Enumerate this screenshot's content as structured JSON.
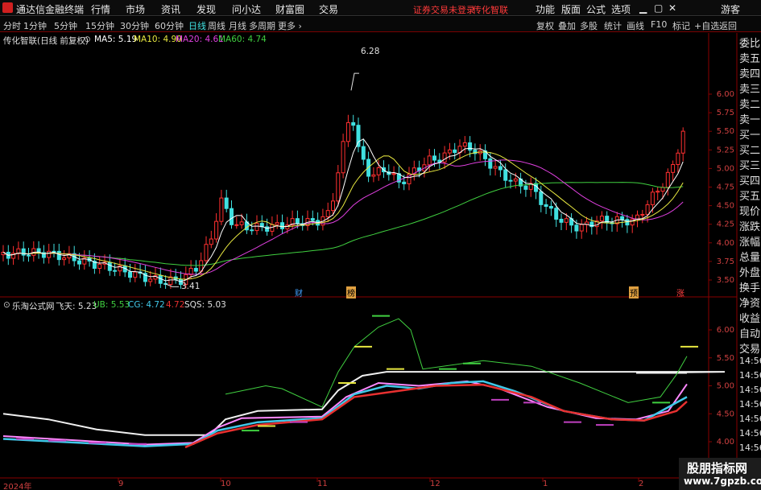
{
  "app": {
    "title": "通达信金融终端",
    "menu": [
      "行情",
      "市场",
      "资讯",
      "发现",
      "问小达",
      "财富圈",
      "交易"
    ],
    "notice": "证券交易未登录",
    "stock_notice": "传化智联",
    "right_menu": [
      "功能",
      "版面",
      "公式",
      "选项"
    ],
    "guest": "游客",
    "window_buttons": [
      "minimize-icon",
      "maximize-icon",
      "close-icon"
    ]
  },
  "toolbar": {
    "periods": [
      "分时",
      "1分钟",
      "5分钟",
      "15分钟",
      "30分钟",
      "60分钟",
      "日线",
      "周线",
      "月线",
      "多周期",
      "更多"
    ],
    "active": "日线",
    "right": [
      "复权",
      "叠加",
      "多股",
      "统计",
      "画线",
      "F10",
      "标记",
      "+自选",
      "返回"
    ]
  },
  "main_chart": {
    "title": "传化智联(日线 前复权)",
    "ma": [
      {
        "label": "MA5: 5.19",
        "color": "#ffffff"
      },
      {
        "label": "MA10: 4.90",
        "color": "#e8e840"
      },
      {
        "label": "MA20: 4.61",
        "color": "#e040e0"
      },
      {
        "label": "MA60: 4.74",
        "color": "#40d040"
      }
    ],
    "high_label": "6.28",
    "low_label": "3.41",
    "tags": [
      "财",
      "榜",
      "预",
      "涨"
    ]
  },
  "indicator": {
    "title": "乐淘公式网",
    "values": [
      {
        "label": "飞天: 5.23",
        "color": "#e0e0e0"
      },
      {
        "label": "UB: 5.53",
        "color": "#40d040"
      },
      {
        "label": "CG: 4.72",
        "color": "#40c8e8"
      },
      {
        "label": "4.72",
        "color": "#e83030"
      },
      {
        "label": "SQS: 5.03",
        "color": "#e0e0e0"
      }
    ]
  },
  "x_axis": [
    "2024年",
    "9",
    "10",
    "11",
    "12",
    "1",
    "2"
  ],
  "side_panel": [
    "委比",
    "卖五",
    "卖四",
    "卖三",
    "卖二",
    "卖一",
    "买一",
    "买二",
    "买三",
    "买四",
    "买五",
    "现价",
    "涨跌",
    "涨幅",
    "总量",
    "外盘",
    "换手",
    "净资",
    "收益",
    "自动",
    "交易"
  ],
  "side_numbers": [
    "14:56",
    "14:56",
    "14:56",
    "14:56",
    "14:56",
    "14:56",
    "14:56"
  ],
  "watermark": {
    "line1": "股朋指标网",
    "line2": "www.7gpzb.com"
  },
  "chart_data": [
    {
      "type": "candlestick",
      "title": "传化智联(日线 前复权)",
      "y_ticks": [
        6.0,
        5.75,
        5.5,
        5.25,
        5.0,
        4.75,
        4.5,
        4.25,
        4.0,
        3.75,
        3.5
      ],
      "ylim": [
        3.4,
        6.45
      ],
      "x_labels": [
        "2024年",
        "9",
        "10",
        "11",
        "12",
        "1",
        "2"
      ],
      "series": [
        {
          "name": "MA5",
          "color": "#ffffff"
        },
        {
          "name": "MA10",
          "color": "#e8e840"
        },
        {
          "name": "MA20",
          "color": "#e040e0"
        },
        {
          "name": "MA60",
          "color": "#40d040"
        }
      ],
      "annotations": [
        {
          "text": "6.28",
          "value": 6.28
        },
        {
          "text": "3.41",
          "value": 3.41
        }
      ]
    },
    {
      "type": "line",
      "title": "乐淘公式网",
      "y_ticks": [
        6.0,
        5.5,
        5.0,
        4.5,
        4.0
      ],
      "ylim": [
        3.6,
        6.5
      ],
      "series": [
        {
          "name": "飞天",
          "value": 5.23
        },
        {
          "name": "UB",
          "value": 5.53
        },
        {
          "name": "CG",
          "value": 4.72
        },
        {
          "name": "SQS",
          "value": 5.03
        }
      ]
    }
  ]
}
